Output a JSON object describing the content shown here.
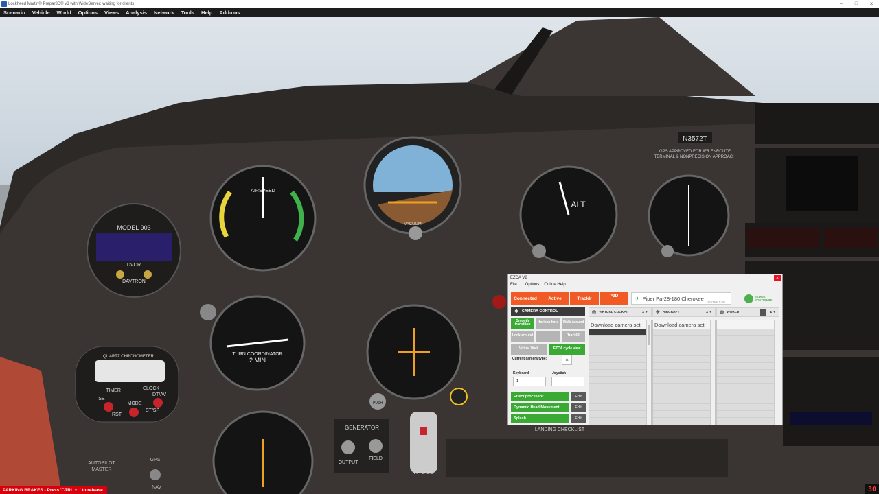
{
  "window": {
    "title": "Lockheed Martin® Prepar3D® v3 with WideServer: waiting for clients",
    "controls": [
      "–",
      "□",
      "✕"
    ]
  },
  "menu": [
    "Scenario",
    "Vehicle",
    "World",
    "Options",
    "Views",
    "Analysis",
    "Network",
    "Tools",
    "Help",
    "Add-ons"
  ],
  "status": {
    "message": "PARKING BRAKES - Press 'CTRL + .' to release.",
    "fps": "30"
  },
  "cockpit": {
    "tail_number": "N3572T",
    "gps_notice_1": "GPS APPROVED FOR IFR ENROUTE",
    "gps_notice_2": "TERMINAL & NONPRECISION APPROACH",
    "dvor_model": "MODEL 903",
    "dvor_label": "DVOR",
    "dvor_brand": "DAVTRON",
    "chrono_label": "QUARTZ CHRONOMETER",
    "chrono_timer": "TIMER",
    "chrono_clock": "CLOCK",
    "chrono_set": "SET",
    "chrono_mode": "MODE",
    "chrono_dtav": "DT/AV",
    "chrono_rst": "RST",
    "chrono_stsp": "ST/SP",
    "turn_coord": "TURN COORDINATOR",
    "turn_min": "2 MIN",
    "airspeed": "AIRSPEED",
    "alt": "ALT",
    "vacuum": "VACUUM",
    "push": "PUSH",
    "generator": "GENERATOR",
    "output": "OUTPUT",
    "field": "FIELD",
    "ap_disc": "AP DISC",
    "landing_checklist": "LANDING CHECKLIST",
    "autopilot": "AUTOPILOT",
    "master": "MASTER",
    "gps": "GPS",
    "nav": "NAV"
  },
  "ezca": {
    "title": "EZCA V2",
    "menu": [
      "File...",
      "Options",
      "Online Help"
    ],
    "tabs": [
      "Connected",
      "Active",
      "TrackIr",
      "P3D"
    ],
    "aircraft_name": "Piper Pa-28-180 Cherokee",
    "aircraft_sub": "SPREE 6.0A",
    "logo_line1": "EZDOK",
    "logo_line2": "SOFTWARE",
    "camera_control": "CAMERA CONTROL",
    "buttons": [
      {
        "label": "Smooth transition",
        "state": "on"
      },
      {
        "label": "Horizon hold",
        "state": "off"
      },
      {
        "label": "Walk Around",
        "state": "off"
      },
      {
        "label": "Look around",
        "state": "off"
      },
      {
        "label": "",
        "state": "off"
      },
      {
        "label": "TrackIR",
        "state": "off"
      },
      {
        "label": "Virtual Walk",
        "state": "off"
      },
      {
        "label": "EZCA cycle view",
        "state": "on"
      }
    ],
    "current_camera_label": "Current camera type:",
    "keyboard_label": "Keyboard",
    "joystick_label": "Joystick",
    "keyboard_value": "1",
    "joystick_value": "",
    "effects": [
      {
        "label": "Effect  processor",
        "edit": "Edit"
      },
      {
        "label": "Dynamic Head Movement",
        "edit": "Edit"
      },
      {
        "label": "Splash",
        "edit": "Edit"
      }
    ],
    "columns": [
      {
        "title": "VIRTUAL COCKPIT",
        "placeholder": "Download camera set"
      },
      {
        "title": "AIRCRAFT",
        "placeholder": "Download camera set"
      },
      {
        "title": "WORLD",
        "placeholder": ""
      }
    ]
  }
}
